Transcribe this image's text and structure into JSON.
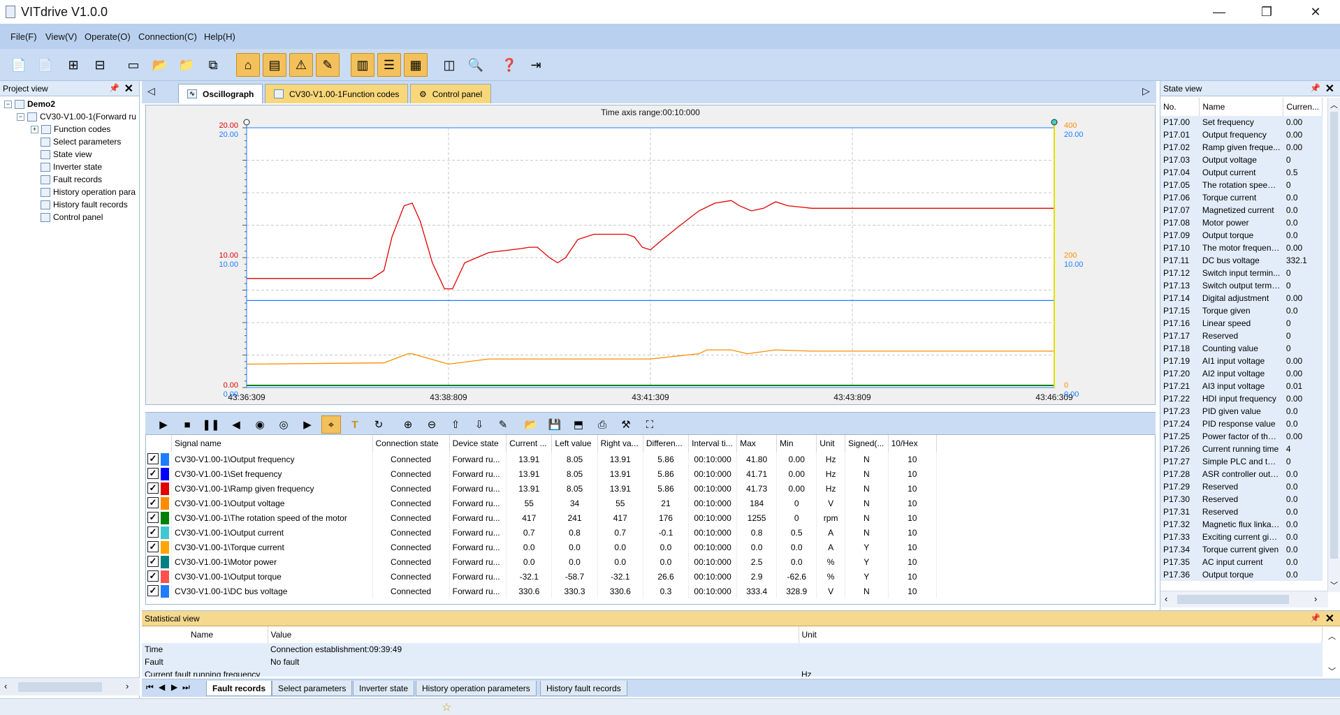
{
  "window": {
    "title": "VITdrive V1.0.0"
  },
  "menu": [
    "File(F)",
    "View(V)",
    "Operate(O)",
    "Connection(C)",
    "Help(H)"
  ],
  "project_view": {
    "title": "Project view",
    "root": "Demo2",
    "device": "CV30-V1.00-1(Forward ru",
    "items": [
      "Function codes",
      "Select parameters",
      "State view",
      "Inverter state",
      "Fault records",
      "History operation para",
      "History fault records",
      "Control panel"
    ]
  },
  "tabs": [
    {
      "label": "Oscillograph"
    },
    {
      "label": "CV30-V1.00-1Function codes"
    },
    {
      "label": "Control panel"
    }
  ],
  "oscillograph": {
    "time_range": "Time axis range:00:10:000",
    "x_ticks": [
      "43:36:309",
      "43:38:809",
      "43:41:309",
      "43:43:809",
      "43:46:309"
    ],
    "left_axis_red": [
      "20.00",
      "10.00",
      "0.00"
    ],
    "left_axis_blue": [
      "20.00",
      "10.00",
      "0.00"
    ],
    "right_axis_orange": [
      "400",
      "200",
      "0"
    ],
    "right_axis_blue": [
      "20.00",
      "10.00",
      "0.00"
    ],
    "colors": {
      "red": "#e00000",
      "blue": "#1e7cff",
      "orange": "#ff8c00",
      "green": "#008000",
      "plot_bg": "#ffffff",
      "grid": "#c8c8c8"
    }
  },
  "signals": {
    "headers": [
      "Signal name",
      "Connection state",
      "Device state",
      "Current ...",
      "Left value",
      "Right va...",
      "Differen...",
      "Interval ti...",
      "Max",
      "Min",
      "Unit",
      "Signed(...",
      "10/Hex"
    ],
    "rows": [
      {
        "color": "#1e7cff",
        "name": "CV30-V1.00-1\\Output frequency",
        "conn": "Connected",
        "dev": "Forward ru...",
        "cur": "13.91",
        "left": "8.05",
        "right": "13.91",
        "diff": "5.86",
        "interval": "00:10:000",
        "max": "41.80",
        "min": "0.00",
        "unit": "Hz",
        "signed": "N",
        "hex": "10"
      },
      {
        "color": "#0000ff",
        "name": "CV30-V1.00-1\\Set frequency",
        "conn": "Connected",
        "dev": "Forward ru...",
        "cur": "13.91",
        "left": "8.05",
        "right": "13.91",
        "diff": "5.86",
        "interval": "00:10:000",
        "max": "41.71",
        "min": "0.00",
        "unit": "Hz",
        "signed": "N",
        "hex": "10"
      },
      {
        "color": "#e00000",
        "name": "CV30-V1.00-1\\Ramp given frequency",
        "conn": "Connected",
        "dev": "Forward ru...",
        "cur": "13.91",
        "left": "8.05",
        "right": "13.91",
        "diff": "5.86",
        "interval": "00:10:000",
        "max": "41.73",
        "min": "0.00",
        "unit": "Hz",
        "signed": "N",
        "hex": "10"
      },
      {
        "color": "#ff8c00",
        "name": "CV30-V1.00-1\\Output voltage",
        "conn": "Connected",
        "dev": "Forward ru...",
        "cur": "55",
        "left": "34",
        "right": "55",
        "diff": "21",
        "interval": "00:10:000",
        "max": "184",
        "min": "0",
        "unit": "V",
        "signed": "N",
        "hex": "10"
      },
      {
        "color": "#008000",
        "name": "CV30-V1.00-1\\The rotation speed of the motor",
        "conn": "Connected",
        "dev": "Forward ru...",
        "cur": "417",
        "left": "241",
        "right": "417",
        "diff": "176",
        "interval": "00:10:000",
        "max": "1255",
        "min": "0",
        "unit": "rpm",
        "signed": "N",
        "hex": "10"
      },
      {
        "color": "#40c8d0",
        "name": "CV30-V1.00-1\\Output current",
        "conn": "Connected",
        "dev": "Forward ru...",
        "cur": "0.7",
        "left": "0.8",
        "right": "0.7",
        "diff": "-0.1",
        "interval": "00:10:000",
        "max": "0.8",
        "min": "0.5",
        "unit": "A",
        "signed": "N",
        "hex": "10"
      },
      {
        "color": "#ffa500",
        "name": "CV30-V1.00-1\\Torque current",
        "conn": "Connected",
        "dev": "Forward ru...",
        "cur": "0.0",
        "left": "0.0",
        "right": "0.0",
        "diff": "0.0",
        "interval": "00:10:000",
        "max": "0.0",
        "min": "0.0",
        "unit": "A",
        "signed": "Y",
        "hex": "10"
      },
      {
        "color": "#008080",
        "name": "CV30-V1.00-1\\Motor power",
        "conn": "Connected",
        "dev": "Forward ru...",
        "cur": "0.0",
        "left": "0.0",
        "right": "0.0",
        "diff": "0.0",
        "interval": "00:10:000",
        "max": "2.5",
        "min": "0.0",
        "unit": "%",
        "signed": "Y",
        "hex": "10"
      },
      {
        "color": "#ff5050",
        "name": "CV30-V1.00-1\\Output torque",
        "conn": "Connected",
        "dev": "Forward ru...",
        "cur": "-32.1",
        "left": "-58.7",
        "right": "-32.1",
        "diff": "26.6",
        "interval": "00:10:000",
        "max": "2.9",
        "min": "-62.6",
        "unit": "%",
        "signed": "Y",
        "hex": "10"
      },
      {
        "color": "#1e7cff",
        "name": "CV30-V1.00-1\\DC bus voltage",
        "conn": "Connected",
        "dev": "Forward ru...",
        "cur": "330.6",
        "left": "330.3",
        "right": "330.6",
        "diff": "0.3",
        "interval": "00:10:000",
        "max": "333.4",
        "min": "328.9",
        "unit": "V",
        "signed": "N",
        "hex": "10"
      }
    ]
  },
  "state_view": {
    "title": "State view",
    "headers": [
      "No.",
      "Name",
      "Curren..."
    ],
    "rows": [
      [
        "P17.00",
        "Set frequency",
        "0.00"
      ],
      [
        "P17.01",
        "Output frequency",
        "0.00"
      ],
      [
        "P17.02",
        "Ramp given freque...",
        "0.00"
      ],
      [
        "P17.03",
        "Output voltage",
        "0"
      ],
      [
        "P17.04",
        "Output current",
        "0.5"
      ],
      [
        "P17.05",
        "The rotation speed ...",
        "0"
      ],
      [
        "P17.06",
        "Torque current",
        "0.0"
      ],
      [
        "P17.07",
        "Magnetized current",
        "0.0"
      ],
      [
        "P17.08",
        "Motor power",
        "0.0"
      ],
      [
        "P17.09",
        "Output torque",
        "0.0"
      ],
      [
        "P17.10",
        "The motor frequenc...",
        "0.00"
      ],
      [
        "P17.11",
        "DC bus voltage",
        "332.1"
      ],
      [
        "P17.12",
        "Switch input termin...",
        "0"
      ],
      [
        "P17.13",
        "Switch output termi...",
        "0"
      ],
      [
        "P17.14",
        "Digital adjustment",
        "0.00"
      ],
      [
        "P17.15",
        "Torque given",
        "0.0"
      ],
      [
        "P17.16",
        "Linear speed",
        "0"
      ],
      [
        "P17.17",
        "Reserved",
        "0"
      ],
      [
        "P17.18",
        "Counting value",
        "0"
      ],
      [
        "P17.19",
        "AI1 input voltage",
        "0.00"
      ],
      [
        "P17.20",
        "AI2 input voltage",
        "0.00"
      ],
      [
        "P17.21",
        "AI3 input voltage",
        "0.01"
      ],
      [
        "P17.22",
        "HDI input frequency",
        "0.00"
      ],
      [
        "P17.23",
        "PID given value",
        "0.0"
      ],
      [
        "P17.24",
        "PID response value",
        "0.0"
      ],
      [
        "P17.25",
        "Power factor of the ...",
        "0.00"
      ],
      [
        "P17.26",
        "Current running time",
        "4"
      ],
      [
        "P17.27",
        "Simple PLC and the...",
        "0"
      ],
      [
        "P17.28",
        "ASR controller output",
        "0.0"
      ],
      [
        "P17.29",
        "Reserved",
        "0.0"
      ],
      [
        "P17.30",
        "Reserved",
        "0.0"
      ],
      [
        "P17.31",
        "Reserved",
        "0.0"
      ],
      [
        "P17.32",
        "Magnetic flux linkage",
        "0.0"
      ],
      [
        "P17.33",
        "Exciting current given",
        "0.0"
      ],
      [
        "P17.34",
        "Torque current given",
        "0.0"
      ],
      [
        "P17.35",
        "AC input current",
        "0.0"
      ],
      [
        "P17.36",
        "Output torque",
        "0.0"
      ]
    ]
  },
  "statistical_view": {
    "title": "Statistical view",
    "headers": [
      "Name",
      "Value",
      "Unit"
    ],
    "rows": [
      [
        "Time",
        "Connection establishment:09:39:49",
        ""
      ],
      [
        "Fault",
        "No fault",
        ""
      ],
      [
        "Current fault running frequency",
        "",
        "Hz"
      ]
    ]
  },
  "bottom_tabs": [
    "Fault records",
    "Select parameters",
    "Inverter state",
    "History operation parameters",
    "History fault records"
  ]
}
